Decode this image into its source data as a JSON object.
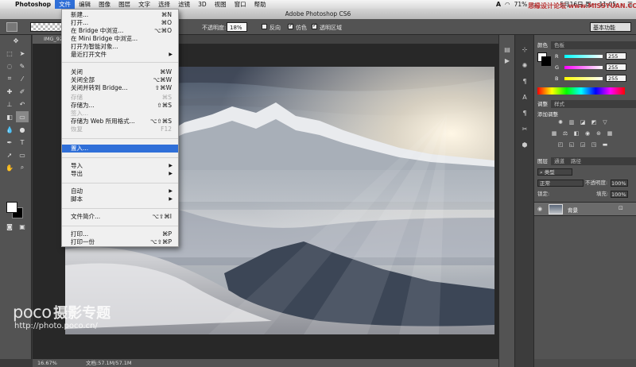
{
  "menubar": {
    "app": "Photoshop",
    "items": [
      "文件",
      "编辑",
      "图像",
      "图层",
      "文字",
      "选择",
      "滤镜",
      "3D",
      "视图",
      "窗口",
      "帮助"
    ],
    "battery": "71%",
    "date": "5月16日 周一 11:05"
  },
  "window": {
    "title": "Adobe Photoshop CS6"
  },
  "options": {
    "opacity_label": "不透明度:",
    "opacity_value": "18%",
    "reverse": "反向",
    "dither": "仿色",
    "transparency": "透明区域",
    "workspace": "基本功能"
  },
  "document": {
    "tab": "IMG_92",
    "zoom": "16.67%",
    "doc_info": "文档:57.1M/57.1M"
  },
  "file_menu": {
    "items": [
      {
        "label": "新建...",
        "shortcut": "⌘N"
      },
      {
        "label": "打开...",
        "shortcut": "⌘O"
      },
      {
        "label": "在 Bridge 中浏览...",
        "shortcut": "⌥⌘O"
      },
      {
        "label": "在 Mini Bridge 中浏览...",
        "shortcut": ""
      },
      {
        "label": "打开为智能对象...",
        "shortcut": ""
      },
      {
        "label": "最近打开文件",
        "shortcut": ""
      },
      {
        "label": "关闭",
        "shortcut": "⌘W"
      },
      {
        "label": "关闭全部",
        "shortcut": "⌥⌘W"
      },
      {
        "label": "关闭并转到 Bridge...",
        "shortcut": "⇧⌘W"
      },
      {
        "label": "存储",
        "shortcut": "⌘S"
      },
      {
        "label": "存储为...",
        "shortcut": "⇧⌘S"
      },
      {
        "label": "签入...",
        "shortcut": ""
      },
      {
        "label": "存储为 Web 所用格式...",
        "shortcut": "⌥⇧⌘S"
      },
      {
        "label": "恢复",
        "shortcut": "F12"
      },
      {
        "label": "置入...",
        "shortcut": ""
      },
      {
        "label": "导入",
        "shortcut": ""
      },
      {
        "label": "导出",
        "shortcut": ""
      },
      {
        "label": "自动",
        "shortcut": ""
      },
      {
        "label": "脚本",
        "shortcut": ""
      },
      {
        "label": "文件简介...",
        "shortcut": "⌥⇧⌘I"
      },
      {
        "label": "打印...",
        "shortcut": "⌘P"
      },
      {
        "label": "打印一份",
        "shortcut": "⌥⇧⌘P"
      }
    ]
  },
  "color_panel": {
    "tabs": [
      "颜色",
      "色板"
    ],
    "r_label": "R",
    "r_value": "255",
    "g_label": "G",
    "g_value": "255",
    "b_label": "B",
    "b_value": "255"
  },
  "adjust_panel": {
    "tabs": [
      "调整",
      "样式"
    ],
    "title": "添加调整"
  },
  "layers_panel": {
    "tabs": [
      "图层",
      "通道",
      "路径"
    ],
    "filter": "类型",
    "blend": "正常",
    "opacity_label": "不透明度:",
    "opacity_value": "100%",
    "lock_label": "锁定:",
    "fill_label": "填充:",
    "fill_value": "100%",
    "layer_name": "背景"
  },
  "watermark": {
    "brand": "poco",
    "name": "摄影专题",
    "url": "http://photo.poco.cn/",
    "corner": "思缘设计论坛 www.MISSYUAN.COM"
  },
  "colors": {
    "menu_highlight": "#2f6fd8",
    "panel": "#535353"
  }
}
